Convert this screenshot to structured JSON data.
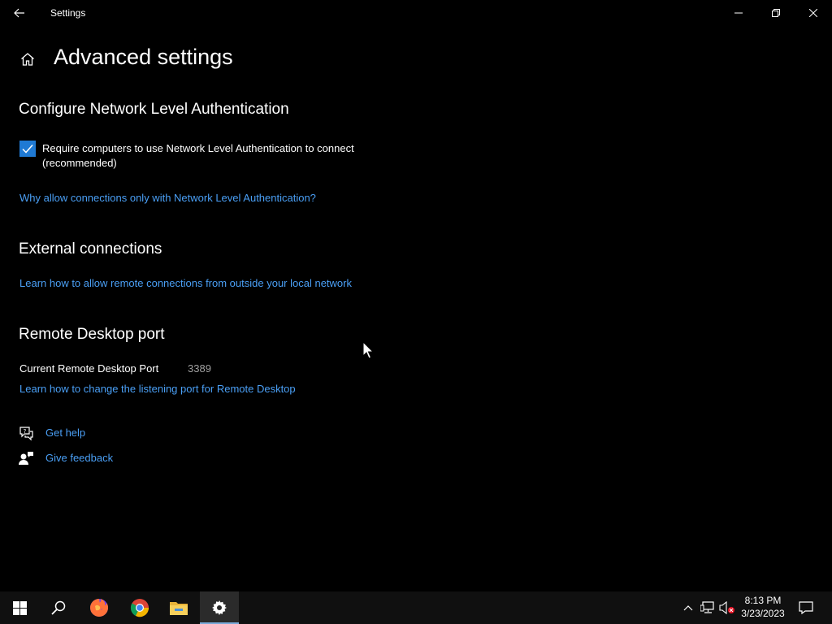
{
  "window": {
    "title": "Settings"
  },
  "page": {
    "title": "Advanced settings"
  },
  "nla": {
    "section_title": "Configure Network Level Authentication",
    "checkbox_label": "Require computers to use Network Level Authentication to connect (recommended)",
    "checked": true,
    "link": "Why allow connections only with Network Level Authentication?"
  },
  "external": {
    "section_title": "External connections",
    "link": "Learn how to allow remote connections from outside your local network"
  },
  "port": {
    "section_title": "Remote Desktop port",
    "label": "Current Remote Desktop Port",
    "value": "3389",
    "link": "Learn how to change the listening port for Remote Desktop"
  },
  "help": {
    "get_help": "Get help",
    "give_feedback": "Give feedback"
  },
  "taskbar": {
    "time": "8:13 PM",
    "date": "3/23/2023",
    "apps": [
      "start-icon",
      "search-icon",
      "firefox-icon",
      "chrome-icon",
      "file-explorer-icon",
      "settings-icon"
    ]
  },
  "colors": {
    "accent": "#1f7ad4",
    "link": "#4a9ff5",
    "background": "#000000",
    "taskbar": "#101010"
  }
}
